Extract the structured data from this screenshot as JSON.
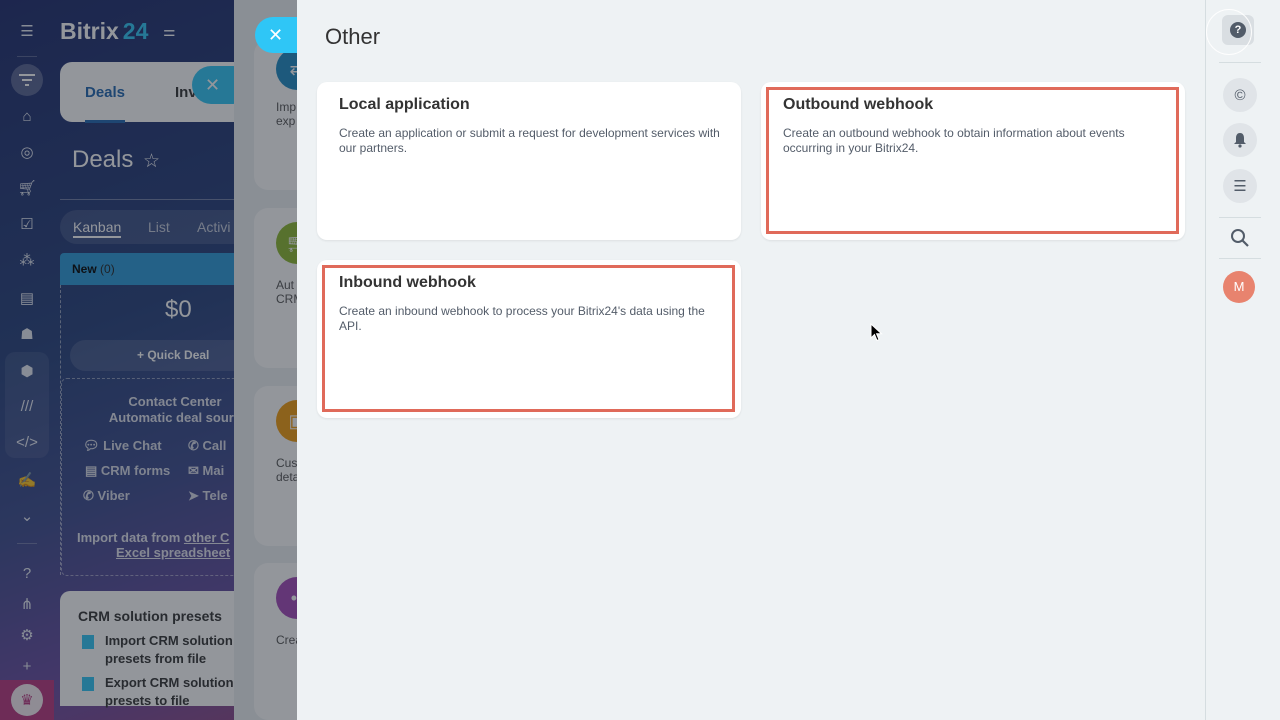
{
  "background_app": {
    "logo_text": "Bitrix",
    "logo_number": "24",
    "tabs": [
      {
        "label": "Deals",
        "active": true
      },
      {
        "label": "Inv"
      }
    ],
    "page_title": "Deals",
    "view_modes": [
      "Kanban",
      "List",
      "Activi"
    ],
    "stage": {
      "name": "New",
      "count": "(0)",
      "sum": "$0"
    },
    "quick_deal_label": "Quick Deal",
    "contact_center": {
      "title_line1": "Contact Center",
      "title_line2": "Automatic deal sourc",
      "items": [
        "Live Chat",
        "Call",
        "CRM forms",
        "Mai",
        "Viber",
        "Tele"
      ],
      "import_text": "Import data from",
      "import_link1": "other C",
      "import_link2": "Excel spreadsheet"
    },
    "presets": {
      "title": "CRM solution presets",
      "items": [
        "Import CRM solution presets from file",
        "Export CRM solution presets to file"
      ]
    },
    "mid_cards": [
      "Imp",
      "exp",
      "Aut",
      "CRM",
      "Cus",
      "deta",
      "Crea"
    ]
  },
  "slider": {
    "title": "Other",
    "close_icon": "close-icon",
    "cards": [
      {
        "title": "Local application",
        "description": "Create an application or submit a request for development services with our partners.",
        "highlighted": false
      },
      {
        "title": "Outbound webhook",
        "description": "Create an outbound webhook to obtain information about events occurring in your Bitrix24.",
        "highlighted": true
      },
      {
        "title": "Inbound webhook",
        "description": "Create an inbound webhook to process your Bitrix24's data using the API.",
        "highlighted": true
      }
    ],
    "highlight_color": "#e06a5a"
  },
  "right_rail": {
    "help_label": "?",
    "avatar_initial": "M",
    "avatar_color": "#e8836e"
  },
  "colors": {
    "accent": "#2fc6f6",
    "panel_bg": "#eef2f4"
  }
}
